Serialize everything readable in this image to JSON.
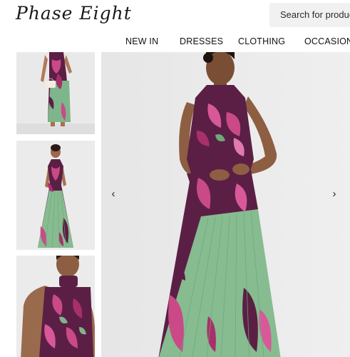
{
  "header": {
    "logo": "Phase Eight",
    "search_placeholder": "Search for products"
  },
  "nav": {
    "items": [
      "NEW IN",
      "DRESSES",
      "CLOTHING",
      "OCCASION"
    ]
  },
  "gallery": {
    "prev_icon": "chevron-left-icon",
    "next_icon": "chevron-right-icon",
    "thumbnails": [
      "thumbnail-full-length-handbag",
      "thumbnail-full-length-front",
      "thumbnail-bodice-closeup"
    ]
  },
  "colors": {
    "dress_purple": "#5b1f45",
    "dress_pink": "#c94a86",
    "dress_green": "#7fb58a",
    "background": "#ebebec"
  }
}
